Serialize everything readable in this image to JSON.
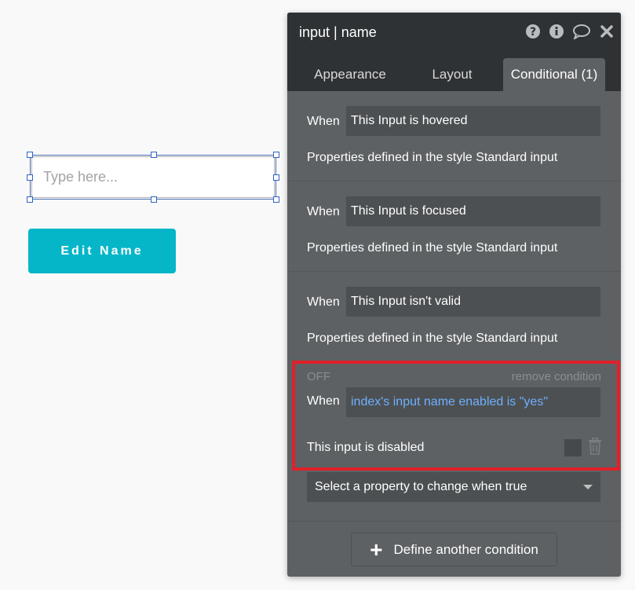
{
  "canvas": {
    "input_placeholder": "Type here...",
    "edit_button_label": "Edit Name",
    "accent_color": "#05b6c9"
  },
  "panel": {
    "title": "input | name",
    "icons": [
      "help-icon",
      "info-icon",
      "comment-icon",
      "close-icon"
    ],
    "tabs": [
      {
        "label": "Appearance",
        "active": false
      },
      {
        "label": "Layout",
        "active": false
      },
      {
        "label": "Conditional (1)",
        "active": true
      }
    ],
    "when_label": "When",
    "conditions": [
      {
        "when": "This Input is hovered",
        "props": "Properties defined in the style Standard input"
      },
      {
        "when": "This Input is focused",
        "props": "Properties defined in the style Standard input"
      },
      {
        "when": "This Input isn't valid",
        "props": "Properties defined in the style Standard input"
      }
    ],
    "custom_condition": {
      "status": "OFF",
      "remove_label": "remove condition",
      "when": "index's input name enabled is \"yes\"",
      "property": "This input is disabled",
      "highlight_color": "#e0202a"
    },
    "select_property_label": "Select a property to change when true",
    "define_button_label": "Define another condition"
  }
}
